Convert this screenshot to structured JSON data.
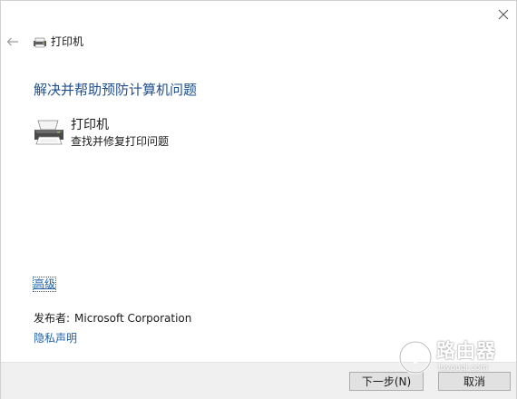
{
  "window": {
    "title": "打印机"
  },
  "heading": "解决并帮助预防计算机问题",
  "troubleshooter": {
    "title": "打印机",
    "description": "查找并修复打印问题"
  },
  "links": {
    "advanced": "高级",
    "privacy": "隐私声明"
  },
  "publisher": {
    "label": "发布者:",
    "value": "Microsoft Corporation"
  },
  "footer": {
    "next_label": "下一步(N)",
    "cancel_label": "取消"
  },
  "watermark": {
    "text": "路由器",
    "url": "luyouqi.com"
  },
  "colors": {
    "heading": "#1e4e8c",
    "link": "#1f5fa8",
    "footer_bg": "#f0f0f0",
    "button_bg": "#e1e1e1"
  },
  "icons": {
    "close": "close-icon",
    "back": "back-arrow-icon",
    "printer": "printer-icon"
  }
}
